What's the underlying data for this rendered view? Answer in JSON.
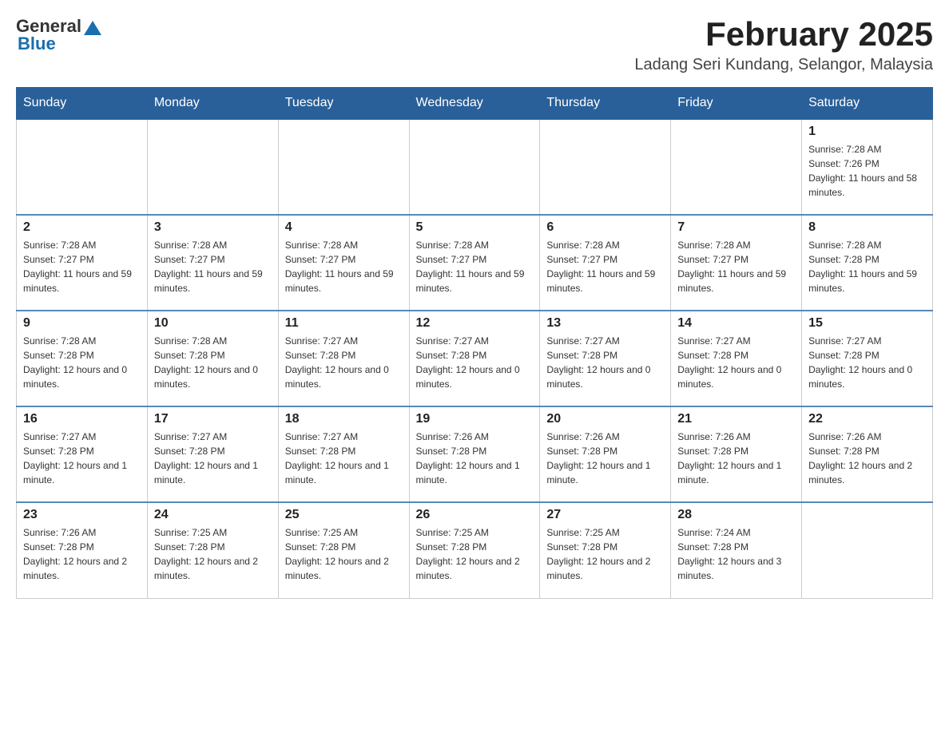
{
  "header": {
    "logo_general": "General",
    "logo_blue": "Blue",
    "month_title": "February 2025",
    "location": "Ladang Seri Kundang, Selangor, Malaysia"
  },
  "days_of_week": [
    "Sunday",
    "Monday",
    "Tuesday",
    "Wednesday",
    "Thursday",
    "Friday",
    "Saturday"
  ],
  "weeks": [
    {
      "cells": [
        {
          "day": "",
          "info": ""
        },
        {
          "day": "",
          "info": ""
        },
        {
          "day": "",
          "info": ""
        },
        {
          "day": "",
          "info": ""
        },
        {
          "day": "",
          "info": ""
        },
        {
          "day": "",
          "info": ""
        },
        {
          "day": "1",
          "info": "Sunrise: 7:28 AM\nSunset: 7:26 PM\nDaylight: 11 hours and 58 minutes."
        }
      ]
    },
    {
      "cells": [
        {
          "day": "2",
          "info": "Sunrise: 7:28 AM\nSunset: 7:27 PM\nDaylight: 11 hours and 59 minutes."
        },
        {
          "day": "3",
          "info": "Sunrise: 7:28 AM\nSunset: 7:27 PM\nDaylight: 11 hours and 59 minutes."
        },
        {
          "day": "4",
          "info": "Sunrise: 7:28 AM\nSunset: 7:27 PM\nDaylight: 11 hours and 59 minutes."
        },
        {
          "day": "5",
          "info": "Sunrise: 7:28 AM\nSunset: 7:27 PM\nDaylight: 11 hours and 59 minutes."
        },
        {
          "day": "6",
          "info": "Sunrise: 7:28 AM\nSunset: 7:27 PM\nDaylight: 11 hours and 59 minutes."
        },
        {
          "day": "7",
          "info": "Sunrise: 7:28 AM\nSunset: 7:27 PM\nDaylight: 11 hours and 59 minutes."
        },
        {
          "day": "8",
          "info": "Sunrise: 7:28 AM\nSunset: 7:28 PM\nDaylight: 11 hours and 59 minutes."
        }
      ]
    },
    {
      "cells": [
        {
          "day": "9",
          "info": "Sunrise: 7:28 AM\nSunset: 7:28 PM\nDaylight: 12 hours and 0 minutes."
        },
        {
          "day": "10",
          "info": "Sunrise: 7:28 AM\nSunset: 7:28 PM\nDaylight: 12 hours and 0 minutes."
        },
        {
          "day": "11",
          "info": "Sunrise: 7:27 AM\nSunset: 7:28 PM\nDaylight: 12 hours and 0 minutes."
        },
        {
          "day": "12",
          "info": "Sunrise: 7:27 AM\nSunset: 7:28 PM\nDaylight: 12 hours and 0 minutes."
        },
        {
          "day": "13",
          "info": "Sunrise: 7:27 AM\nSunset: 7:28 PM\nDaylight: 12 hours and 0 minutes."
        },
        {
          "day": "14",
          "info": "Sunrise: 7:27 AM\nSunset: 7:28 PM\nDaylight: 12 hours and 0 minutes."
        },
        {
          "day": "15",
          "info": "Sunrise: 7:27 AM\nSunset: 7:28 PM\nDaylight: 12 hours and 0 minutes."
        }
      ]
    },
    {
      "cells": [
        {
          "day": "16",
          "info": "Sunrise: 7:27 AM\nSunset: 7:28 PM\nDaylight: 12 hours and 1 minute."
        },
        {
          "day": "17",
          "info": "Sunrise: 7:27 AM\nSunset: 7:28 PM\nDaylight: 12 hours and 1 minute."
        },
        {
          "day": "18",
          "info": "Sunrise: 7:27 AM\nSunset: 7:28 PM\nDaylight: 12 hours and 1 minute."
        },
        {
          "day": "19",
          "info": "Sunrise: 7:26 AM\nSunset: 7:28 PM\nDaylight: 12 hours and 1 minute."
        },
        {
          "day": "20",
          "info": "Sunrise: 7:26 AM\nSunset: 7:28 PM\nDaylight: 12 hours and 1 minute."
        },
        {
          "day": "21",
          "info": "Sunrise: 7:26 AM\nSunset: 7:28 PM\nDaylight: 12 hours and 1 minute."
        },
        {
          "day": "22",
          "info": "Sunrise: 7:26 AM\nSunset: 7:28 PM\nDaylight: 12 hours and 2 minutes."
        }
      ]
    },
    {
      "cells": [
        {
          "day": "23",
          "info": "Sunrise: 7:26 AM\nSunset: 7:28 PM\nDaylight: 12 hours and 2 minutes."
        },
        {
          "day": "24",
          "info": "Sunrise: 7:25 AM\nSunset: 7:28 PM\nDaylight: 12 hours and 2 minutes."
        },
        {
          "day": "25",
          "info": "Sunrise: 7:25 AM\nSunset: 7:28 PM\nDaylight: 12 hours and 2 minutes."
        },
        {
          "day": "26",
          "info": "Sunrise: 7:25 AM\nSunset: 7:28 PM\nDaylight: 12 hours and 2 minutes."
        },
        {
          "day": "27",
          "info": "Sunrise: 7:25 AM\nSunset: 7:28 PM\nDaylight: 12 hours and 2 minutes."
        },
        {
          "day": "28",
          "info": "Sunrise: 7:24 AM\nSunset: 7:28 PM\nDaylight: 12 hours and 3 minutes."
        },
        {
          "day": "",
          "info": ""
        }
      ]
    }
  ]
}
